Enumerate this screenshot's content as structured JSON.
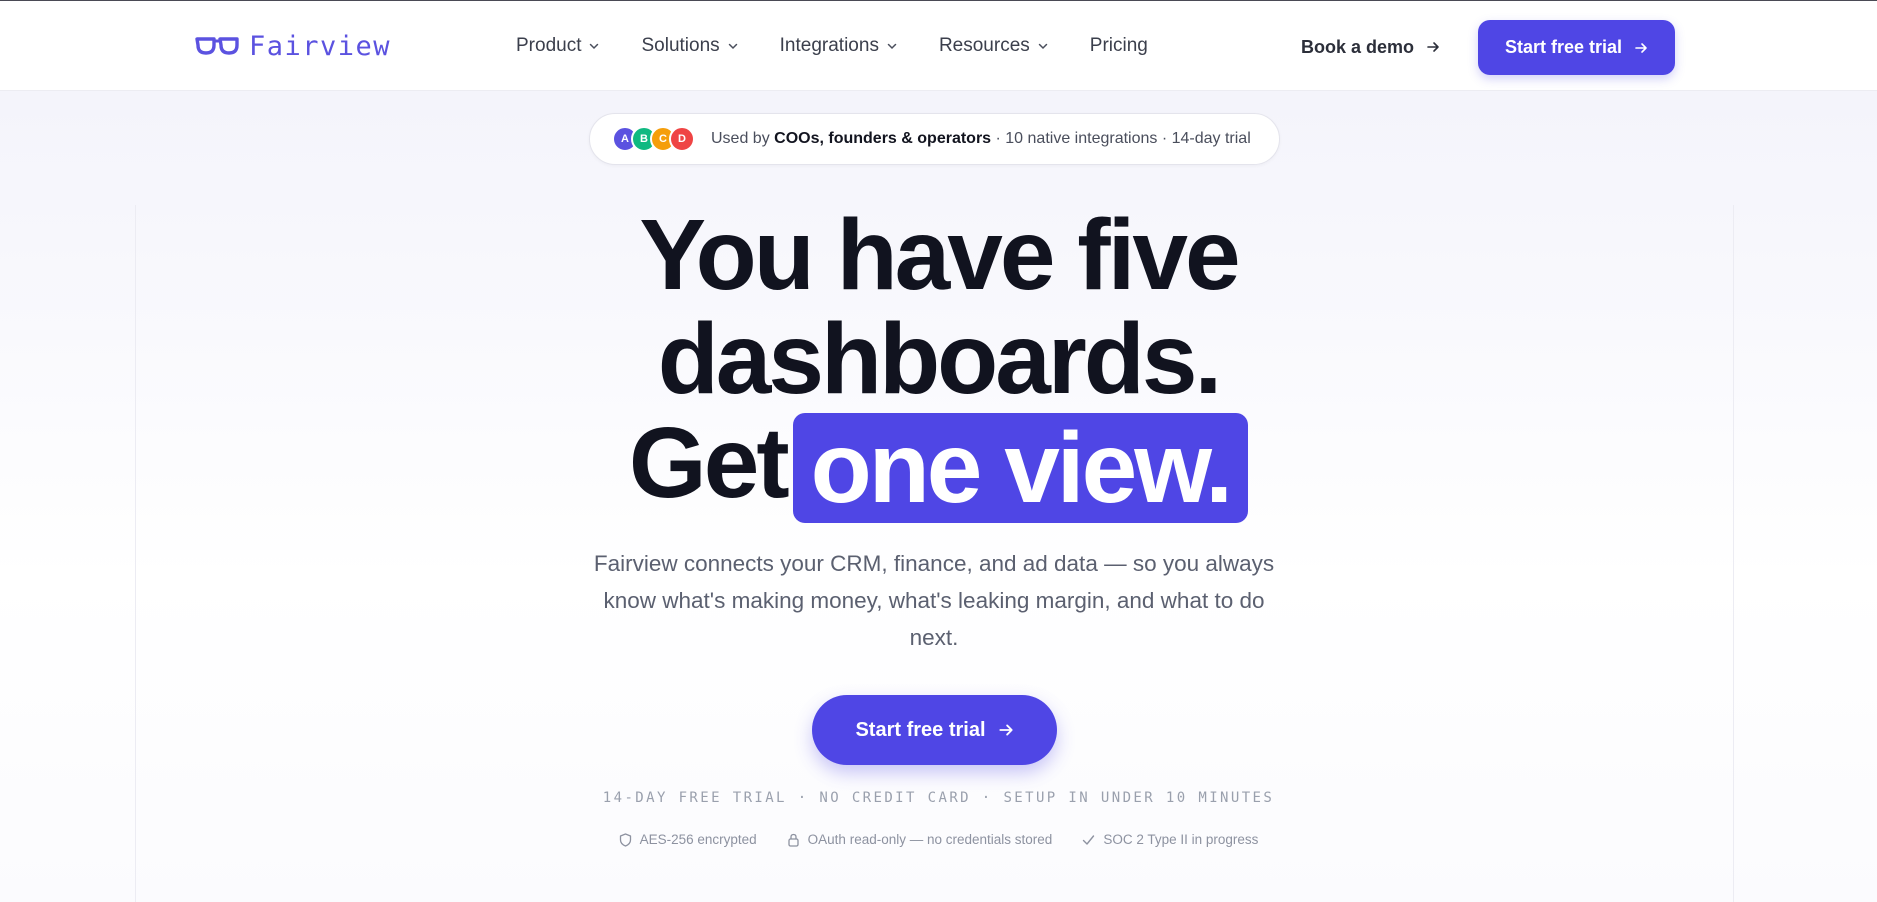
{
  "header": {
    "logo_text": "Fairview",
    "nav": [
      {
        "label": "Product",
        "has_dropdown": true
      },
      {
        "label": "Solutions",
        "has_dropdown": true
      },
      {
        "label": "Integrations",
        "has_dropdown": true
      },
      {
        "label": "Resources",
        "has_dropdown": true
      },
      {
        "label": "Pricing",
        "has_dropdown": false
      }
    ],
    "book_demo_label": "Book a demo",
    "start_trial_label": "Start free trial"
  },
  "badge": {
    "avatars": [
      "A",
      "B",
      "C",
      "D"
    ],
    "avatar_colors": [
      "#5b52e0",
      "#10b981",
      "#f59e0b",
      "#ef4444"
    ],
    "prefix": "Used by ",
    "highlight": "COOs, founders & operators",
    "suffix": " · 10 native integrations · 14-day trial"
  },
  "hero": {
    "line1": "You have five",
    "line2": "dashboards.",
    "line3_plain": "Get",
    "line3_highlight": "one view.",
    "lead": "Fairview connects your CRM, finance, and ad data — so you always know what's making money, what's leaking margin, and what to do next.",
    "cta_label": "Start free trial",
    "fine_print": "14-DAY FREE TRIAL · NO CREDIT CARD · SETUP IN UNDER 10 MINUTES"
  },
  "trust": [
    {
      "icon": "shield-icon",
      "label": "AES-256 encrypted"
    },
    {
      "icon": "lock-icon",
      "label": "OAuth read-only — no credentials stored"
    },
    {
      "icon": "check-icon",
      "label": "SOC 2 Type II in progress"
    }
  ],
  "colors": {
    "accent": "#4f46e5",
    "heading": "#11131f",
    "muted": "#5b6070"
  }
}
